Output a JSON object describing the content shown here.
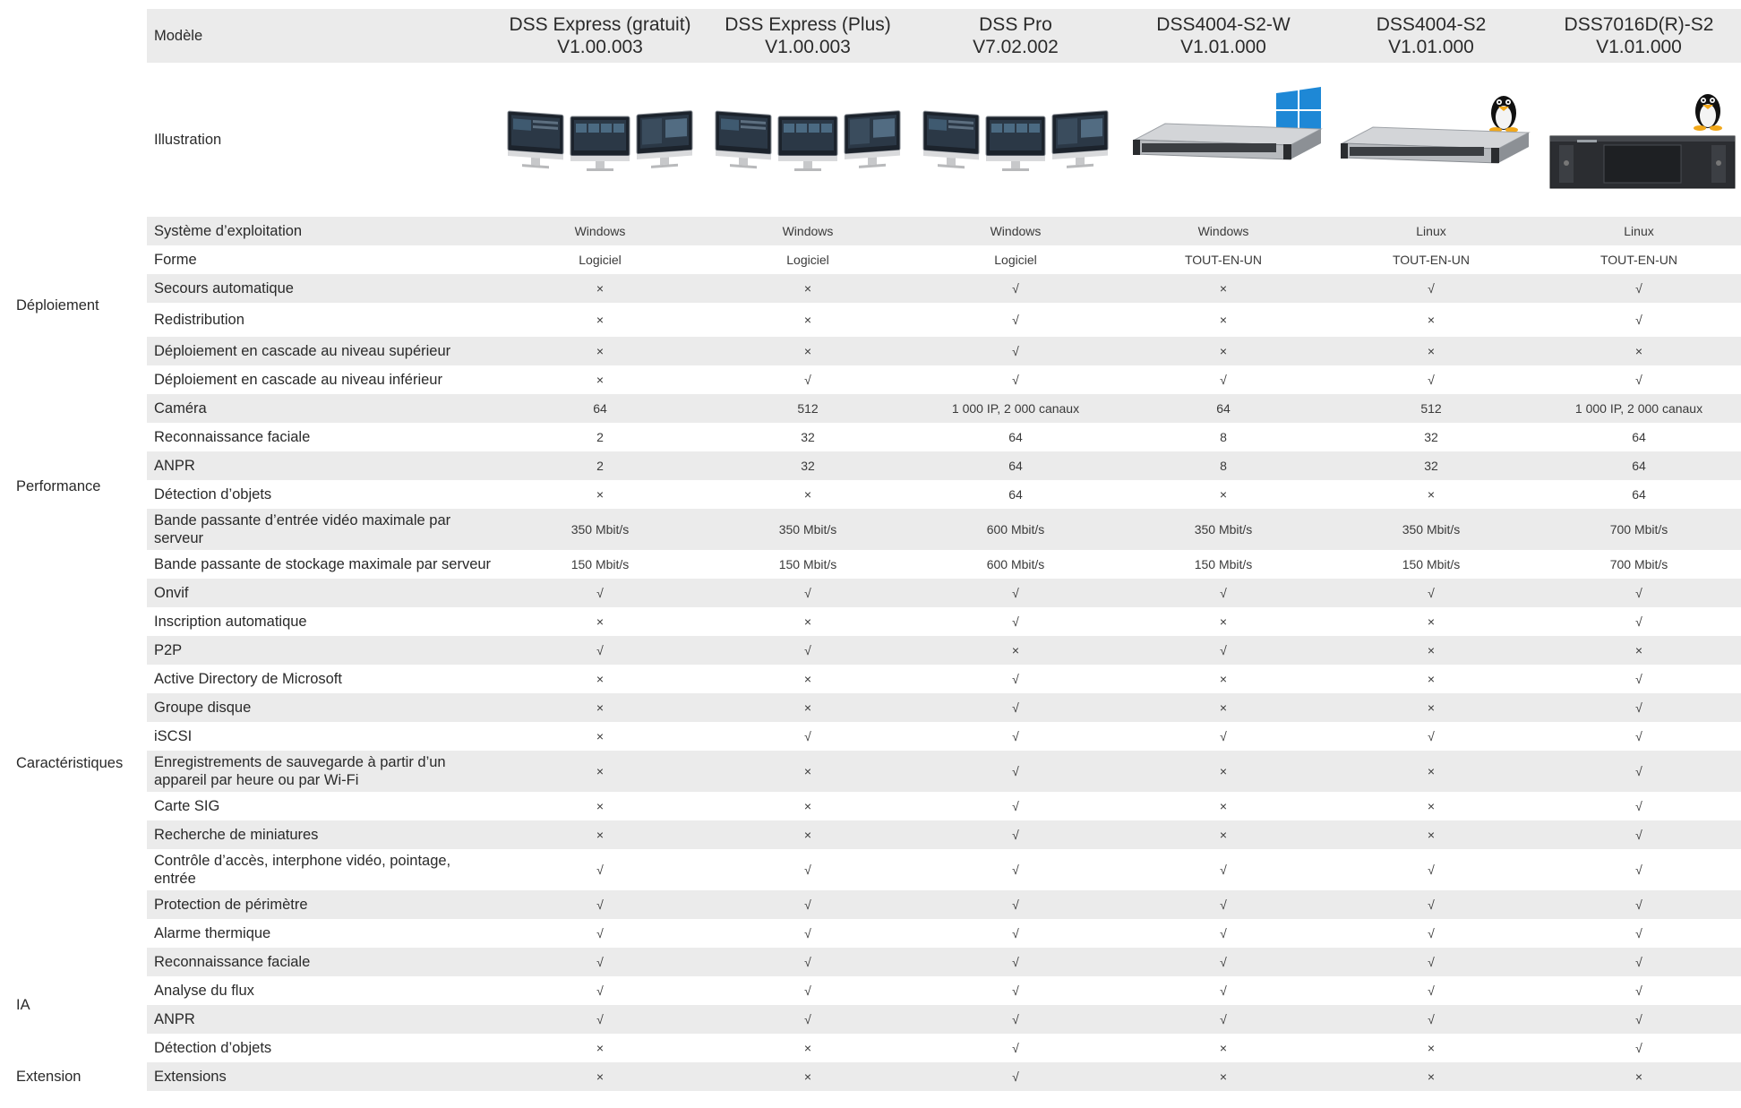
{
  "header": {
    "model_label": "Modèle",
    "illustration_label": "Illustration",
    "products": [
      {
        "name": "DSS Express (gratuit)",
        "version": "V1.00.003",
        "illustration": "three-monitors-image",
        "os_icon": ""
      },
      {
        "name": "DSS Express (Plus)",
        "version": "V1.00.003",
        "illustration": "three-monitors-image",
        "os_icon": ""
      },
      {
        "name": "DSS Pro",
        "version": "V7.02.002",
        "illustration": "three-monitors-image",
        "os_icon": ""
      },
      {
        "name": "DSS4004-S2-W",
        "version": "V1.01.000",
        "illustration": "rack-server-1u-image",
        "os_icon": "windows-logo-icon"
      },
      {
        "name": "DSS4004-S2",
        "version": "V1.01.000",
        "illustration": "rack-server-1u-image",
        "os_icon": "linux-tux-icon"
      },
      {
        "name": "DSS7016D(R)-S2",
        "version": "V1.01.000",
        "illustration": "rack-server-3u-image",
        "os_icon": "linux-tux-icon"
      }
    ]
  },
  "groups": [
    {
      "name": "Déploiement",
      "rows": [
        {
          "label": "Système d’exploitation",
          "values": [
            "Windows",
            "Windows",
            "Windows",
            "Windows",
            "Linux",
            "Linux"
          ]
        },
        {
          "label": "Forme",
          "values": [
            "Logiciel",
            "Logiciel",
            "Logiciel",
            "TOUT-EN-UN",
            "TOUT-EN-UN",
            "TOUT-EN-UN"
          ]
        },
        {
          "label": "Secours automatique",
          "values": [
            "×",
            "×",
            "√",
            "×",
            "√",
            "√"
          ]
        },
        {
          "label": "Redistribution",
          "values": [
            "×",
            "×",
            "√",
            "×",
            "×",
            "√"
          ]
        },
        {
          "label": "Déploiement en cascade au niveau supérieur",
          "values": [
            "×",
            "×",
            "√",
            "×",
            "×",
            "×"
          ]
        },
        {
          "label": "Déploiement en cascade au niveau inférieur",
          "values": [
            "×",
            "√",
            "√",
            "√",
            "√",
            "√"
          ]
        }
      ]
    },
    {
      "name": "Performance",
      "rows": [
        {
          "label": "Caméra",
          "values": [
            "64",
            "512",
            "1 000 IP, 2 000 canaux",
            "64",
            "512",
            "1 000 IP, 2 000 canaux"
          ]
        },
        {
          "label": "Reconnaissance faciale",
          "values": [
            "2",
            "32",
            "64",
            "8",
            "32",
            "64"
          ]
        },
        {
          "label": "ANPR",
          "values": [
            "2",
            "32",
            "64",
            "8",
            "32",
            "64"
          ]
        },
        {
          "label": "Détection d’objets",
          "values": [
            "×",
            "×",
            "64",
            "×",
            "×",
            "64"
          ]
        },
        {
          "label": "Bande passante d’entrée vidéo maximale par serveur",
          "values": [
            "350 Mbit/s",
            "350 Mbit/s",
            "600 Mbit/s",
            "350 Mbit/s",
            "350 Mbit/s",
            "700 Mbit/s"
          ]
        },
        {
          "label": "Bande passante de stockage maximale par serveur",
          "values": [
            "150 Mbit/s",
            "150 Mbit/s",
            "600 Mbit/s",
            "150 Mbit/s",
            "150 Mbit/s",
            "700 Mbit/s"
          ]
        }
      ]
    },
    {
      "name": "Caractéristiques",
      "rows": [
        {
          "label": "Onvif",
          "values": [
            "√",
            "√",
            "√",
            "√",
            "√",
            "√"
          ]
        },
        {
          "label": "Inscription automatique",
          "values": [
            "×",
            "×",
            "√",
            "×",
            "×",
            "√"
          ]
        },
        {
          "label": "P2P",
          "values": [
            "√",
            "√",
            "×",
            "√",
            "×",
            "×"
          ]
        },
        {
          "label": "Active Directory de Microsoft",
          "values": [
            "×",
            "×",
            "√",
            "×",
            "×",
            "√"
          ]
        },
        {
          "label": "Groupe disque",
          "values": [
            "×",
            "×",
            "√",
            "×",
            "×",
            "√"
          ]
        },
        {
          "label": "iSCSI",
          "values": [
            "×",
            "√",
            "√",
            "√",
            "√",
            "√"
          ]
        },
        {
          "label": "Enregistrements de sauvegarde à partir d’un appareil par heure ou par Wi-Fi",
          "values": [
            "×",
            "×",
            "√",
            "×",
            "×",
            "√"
          ]
        },
        {
          "label": "Carte SIG",
          "values": [
            "×",
            "×",
            "√",
            "×",
            "×",
            "√"
          ]
        },
        {
          "label": "Recherche de miniatures",
          "values": [
            "×",
            "×",
            "√",
            "×",
            "×",
            "√"
          ]
        },
        {
          "label": "Contrôle d’accès, interphone vidéo, pointage, entrée",
          "values": [
            "√",
            "√",
            "√",
            "√",
            "√",
            "√"
          ]
        },
        {
          "label": "Protection de périmètre",
          "values": [
            "√",
            "√",
            "√",
            "√",
            "√",
            "√"
          ]
        },
        {
          "label": "Alarme thermique",
          "values": [
            "√",
            "√",
            "√",
            "√",
            "√",
            "√"
          ]
        }
      ]
    },
    {
      "name": "IA",
      "rows": [
        {
          "label": "Reconnaissance faciale",
          "values": [
            "√",
            "√",
            "√",
            "√",
            "√",
            "√"
          ]
        },
        {
          "label": "Analyse du flux",
          "values": [
            "√",
            "√",
            "√",
            "√",
            "√",
            "√"
          ]
        },
        {
          "label": "ANPR",
          "values": [
            "√",
            "√",
            "√",
            "√",
            "√",
            "√"
          ]
        },
        {
          "label": "Détection d’objets",
          "values": [
            "×",
            "×",
            "√",
            "×",
            "×",
            "√"
          ]
        }
      ]
    },
    {
      "name": "Extension",
      "rows": [
        {
          "label": "Extensions",
          "values": [
            "×",
            "×",
            "√",
            "×",
            "×",
            "×"
          ]
        }
      ]
    }
  ]
}
